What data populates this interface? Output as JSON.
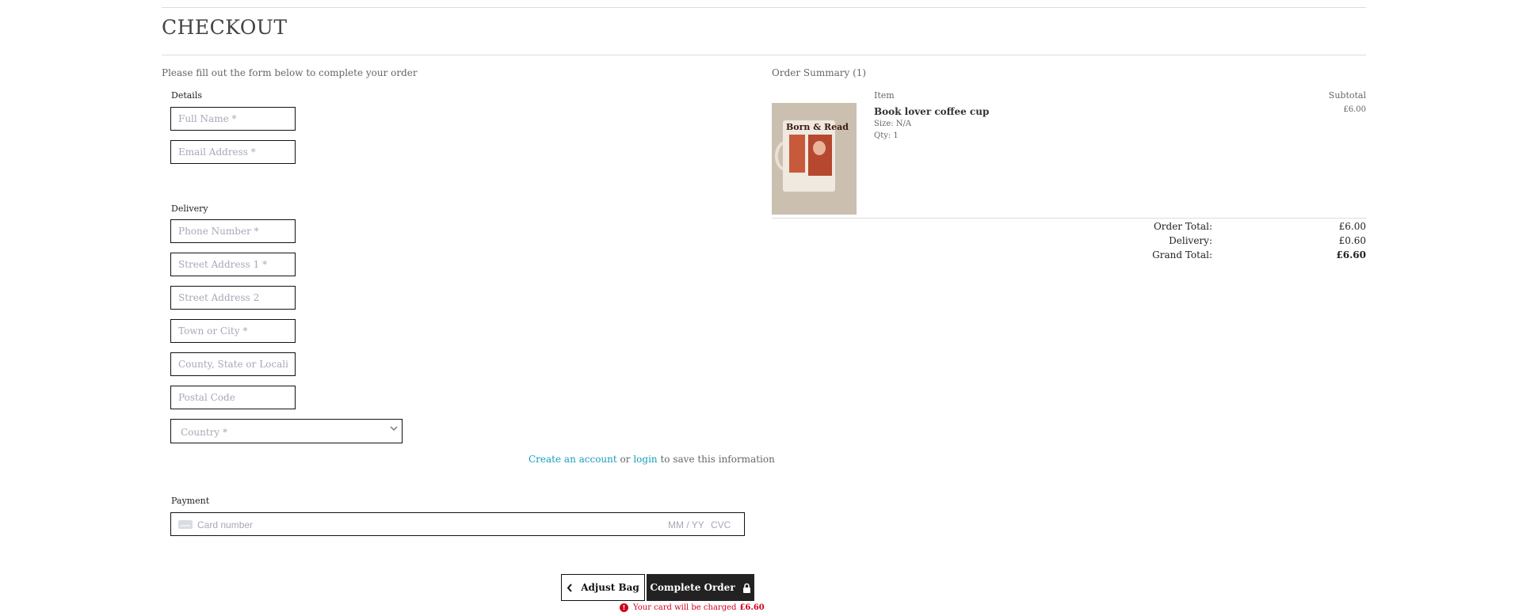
{
  "page": {
    "title": "CHECKOUT",
    "subtitle": "Please fill out the form below to complete your order"
  },
  "details": {
    "heading": "Details",
    "full_name_placeholder": "Full Name *",
    "email_placeholder": "Email Address *"
  },
  "delivery": {
    "heading": "Delivery",
    "phone_placeholder": "Phone Number *",
    "street1_placeholder": "Street Address 1 *",
    "street2_placeholder": "Street Address 2",
    "town_placeholder": "Town or City *",
    "county_placeholder": "County, State or Locality",
    "postcode_placeholder": "Postal Code",
    "country_placeholder": "Country *"
  },
  "save_info": {
    "create_link": "Create an account",
    "or": "or",
    "login_link": "login",
    "suffix": "to save this information"
  },
  "payment": {
    "heading": "Payment",
    "card_number_placeholder": "Card number",
    "expiry_placeholder": "MM / YY",
    "cvc_placeholder": "CVC"
  },
  "actions": {
    "adjust_label": "Adjust Bag",
    "complete_label": "Complete Order",
    "charge_prefix": "Your card will be charged",
    "charge_amount": "£6.60"
  },
  "summary": {
    "heading": "Order Summary (1)",
    "item_col": "Item",
    "subtotal_col": "Subtotal",
    "item": {
      "name": "Book lover coffee cup",
      "size": "Size: N/A",
      "qty": "Qty: 1",
      "subtotal": "£6.00",
      "image_text": "Born & Read"
    },
    "order_total_label": "Order Total:",
    "order_total_value": "£6.00",
    "delivery_label": "Delivery:",
    "delivery_value": "£0.60",
    "grand_total_label": "Grand Total:",
    "grand_total_value": "£6.60"
  },
  "icons": {
    "back": "chevron-left-icon",
    "lock": "lock-icon",
    "error": "exclamation-icon",
    "card": "credit-card-icon",
    "select": "chevron-down-icon"
  },
  "colors": {
    "link": "#1a9dbd",
    "error": "#d0021b",
    "primary_button": "#222222"
  }
}
